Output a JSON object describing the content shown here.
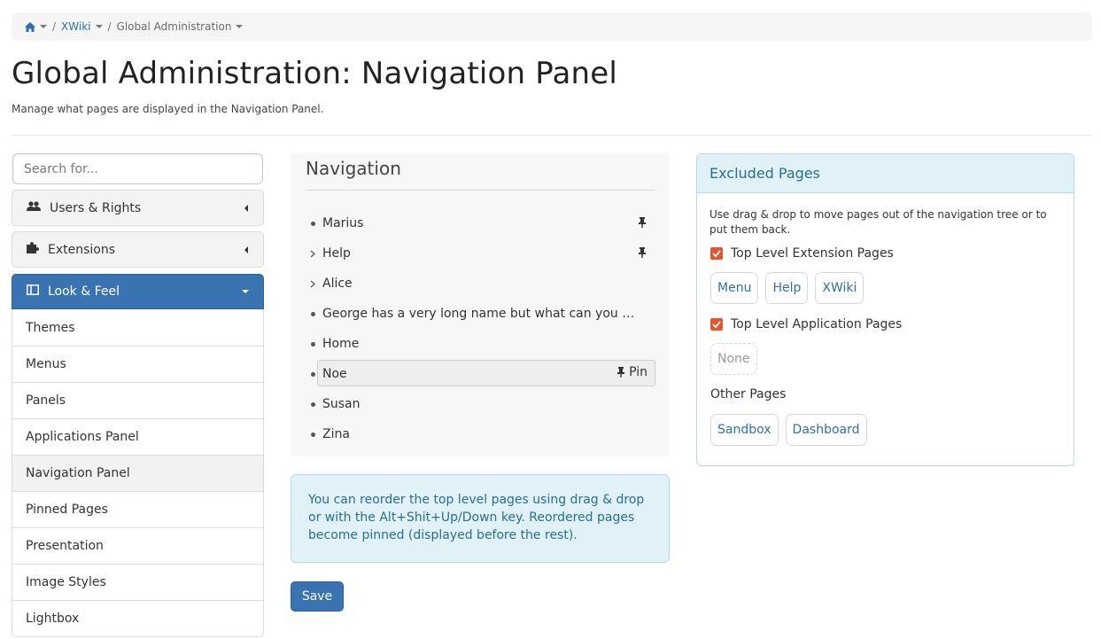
{
  "breadcrumb": {
    "items": [
      "XWiki",
      "Global Administration"
    ]
  },
  "page": {
    "title": "Global Administration: Navigation Panel",
    "description": "Manage what pages are displayed in the Navigation Panel."
  },
  "sidebar": {
    "search_placeholder": "Search for...",
    "categories": [
      {
        "label": "Users & Rights"
      },
      {
        "label": "Extensions"
      },
      {
        "label": "Look & Feel"
      }
    ],
    "subitems": [
      "Themes",
      "Menus",
      "Panels",
      "Applications Panel",
      "Navigation Panel",
      "Pinned Pages",
      "Presentation",
      "Image Styles",
      "Lightbox"
    ]
  },
  "navigation": {
    "title": "Navigation",
    "nodes": [
      {
        "label": "Marius"
      },
      {
        "label": "Help"
      },
      {
        "label": "Alice"
      },
      {
        "label": "George has a very long name but what can you do about it"
      },
      {
        "label": "Home"
      },
      {
        "label": "Noe"
      },
      {
        "label": "Susan"
      },
      {
        "label": "Zina"
      }
    ],
    "pin_label": "Pin",
    "info": "You can reorder the top level pages using drag & drop or with the Alt+Shit+Up/Down key. Reordered pages become pinned (displayed before the rest).",
    "save_label": "Save"
  },
  "excluded": {
    "title": "Excluded Pages",
    "description": "Use drag & drop to move pages out of the navigation tree or to put them back.",
    "top_extension_label": "Top Level Extension Pages",
    "top_extension_pages": [
      "Menu",
      "Help",
      "XWiki"
    ],
    "top_application_label": "Top Level Application Pages",
    "top_application_empty": "None",
    "other_label": "Other Pages",
    "other_pages": [
      "Sandbox",
      "Dashboard"
    ]
  },
  "colors": {
    "primary": "#3a73b1",
    "info_bg": "#e1f1f8",
    "checkbox": "#e4572e"
  }
}
